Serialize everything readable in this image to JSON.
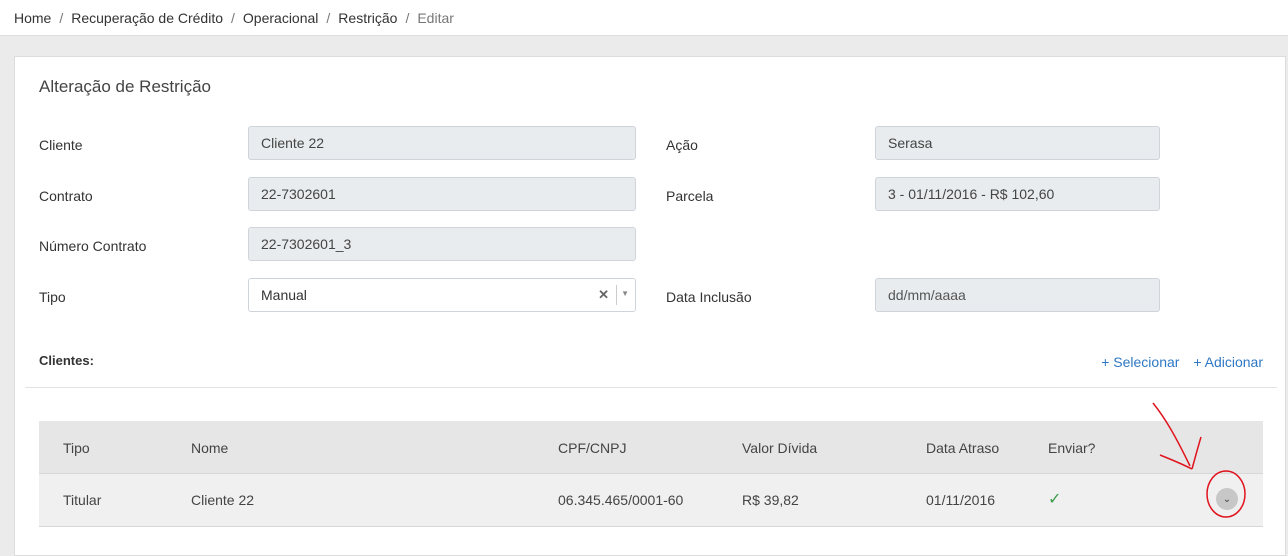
{
  "breadcrumb": {
    "items": [
      "Home",
      "Recuperação de Crédito",
      "Operacional",
      "Restrição"
    ],
    "current": "Editar",
    "separator": "/"
  },
  "panel": {
    "title": "Alteração de Restrição"
  },
  "form": {
    "cliente_label": "Cliente",
    "cliente_value": "Cliente 22",
    "contrato_label": "Contrato",
    "contrato_value": "22-7302601",
    "numero_contrato_label": "Número Contrato",
    "numero_contrato_value": "22-7302601_3",
    "tipo_label": "Tipo",
    "tipo_value": "Manual",
    "acao_label": "Ação",
    "acao_value": "Serasa",
    "parcela_label": "Parcela",
    "parcela_value": "3 - 01/11/2016 - R$ 102,60",
    "data_inclusao_label": "Data Inclusão",
    "data_inclusao_placeholder": "dd/mm/aaaa"
  },
  "clientes": {
    "title": "Clientes:",
    "selecionar_label": "+ Selecionar",
    "adicionar_label": "+ Adicionar"
  },
  "table": {
    "headers": [
      "Tipo",
      "Nome",
      "CPF/CNPJ",
      "Valor Dívida",
      "Data Atraso",
      "Enviar?"
    ],
    "rows": [
      {
        "tipo": "Titular",
        "nome": "Cliente 22",
        "cpf_cnpj": "06.345.465/0001-60",
        "valor_divida": "R$ 39,82",
        "data_atraso": "01/11/2016",
        "enviar": "✓"
      }
    ]
  },
  "icons": {
    "clear": "clear-icon",
    "dropdown": "chevron-down-icon",
    "check": "check-icon",
    "expand": "expand-icon"
  },
  "colors": {
    "link": "#2f78c4",
    "check": "#3a9d4a",
    "annotation": "#e0141e"
  }
}
